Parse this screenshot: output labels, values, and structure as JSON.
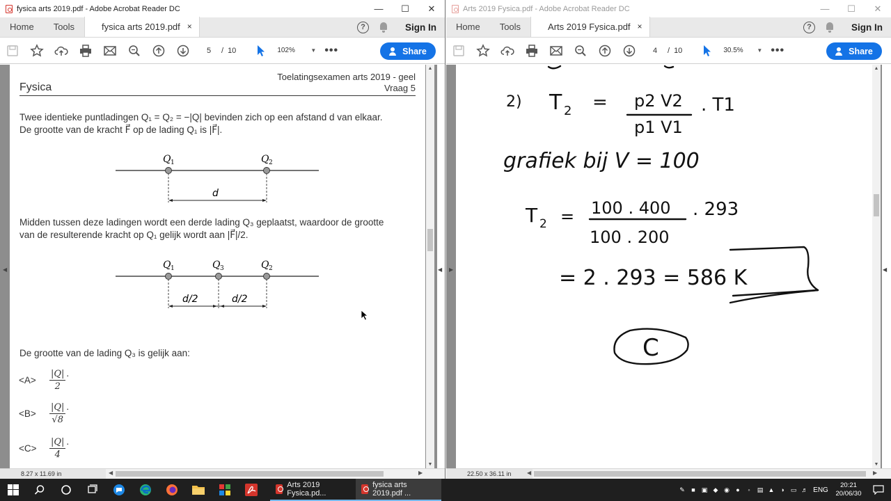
{
  "left_window": {
    "title": "fysica arts 2019.pdf - Adobe Acrobat Reader DC",
    "menu": {
      "home": "Home",
      "tools": "Tools",
      "tab_label": "fysica arts 2019.pdf",
      "tab_close": "×",
      "sign_in": "Sign In",
      "help": "?"
    },
    "toolbar": {
      "page_current": "5",
      "page_sep": "/",
      "page_total": "10",
      "zoom": "102%",
      "more": "•••",
      "share": "Share"
    },
    "status": {
      "dimensions": "8.27 x 11.69 in"
    },
    "document": {
      "header_right_1": "Toelatingsexamen arts 2019 - geel",
      "header_right_2": "Vraag 5",
      "header_left": "Fysica",
      "intro_line1": "Twee identieke puntladingen Q₁ = Q₂ = −|Q| bevinden zich op een afstand d van elkaar.",
      "intro_line2": "De grootte van de kracht F⃗ op de lading Q₁ is |F⃗|.",
      "fig1": {
        "q1": "Q",
        "q1_sub": "1",
        "q2": "Q",
        "q2_sub": "2",
        "d": "d"
      },
      "mid_line1": "Midden tussen deze ladingen wordt een derde lading Q₃ geplaatst, waardoor de grootte",
      "mid_line2": "van de resulterende kracht op Q₁ gelijk wordt aan |F⃗|/2.",
      "fig2": {
        "q1": "Q",
        "q1_sub": "1",
        "q3": "Q",
        "q3_sub": "3",
        "q2": "Q",
        "q2_sub": "2",
        "d_half_1": "d/2",
        "d_half_2": "d/2"
      },
      "question": "De grootte van de lading Q₃ is gelijk aan:",
      "options": [
        {
          "label": "<A>",
          "num": "|Q|",
          "den": "2",
          "dot": "."
        },
        {
          "label": "<B>",
          "num": "|Q|",
          "den": "√8",
          "dot": "."
        },
        {
          "label": "<C>",
          "num": "|Q|",
          "den": "4",
          "dot": "."
        }
      ]
    }
  },
  "right_window": {
    "title": "Arts 2019 Fysica.pdf - Adobe Acrobat Reader DC",
    "menu": {
      "home": "Home",
      "tools": "Tools",
      "tab_label": "Arts 2019 Fysica.pdf",
      "tab_close": "×",
      "sign_in": "Sign In",
      "help": "?"
    },
    "toolbar": {
      "page_current": "4",
      "page_sep": "/",
      "page_total": "10",
      "zoom": "30.5%",
      "more": "•••",
      "share": "Share"
    },
    "status": {
      "dimensions": "22.50 x 36.11 in"
    },
    "handwriting": {
      "line1_label": "2)",
      "line1_t2": "T",
      "line1_sub": "2",
      "line1_eq": "=",
      "line1_num": "p2 V2",
      "line1_den": "p1 V1",
      "line1_t1": ". T1",
      "line2": "grafiek bij V = 100",
      "line3_t2": "T",
      "line3_sub": "2",
      "line3_eq": "=",
      "line3_num": "100 . 400",
      "line3_den": "100 . 200",
      "line3_mult": ". 293",
      "line4": "= 2 . 293 = 586 K",
      "answer": "C"
    }
  },
  "taskbar": {
    "tasks": [
      {
        "label": "Arts 2019 Fysica.pd..."
      },
      {
        "label": "fysica arts 2019.pdf ..."
      }
    ],
    "language": "ENG",
    "time": "20:21",
    "date": "20/06/30"
  },
  "colors": {
    "share_blue": "#1473e6",
    "taskbar": "#1f1f1f",
    "pdf_red": "#d4352c",
    "viewer_gray": "#8d8d8d"
  }
}
